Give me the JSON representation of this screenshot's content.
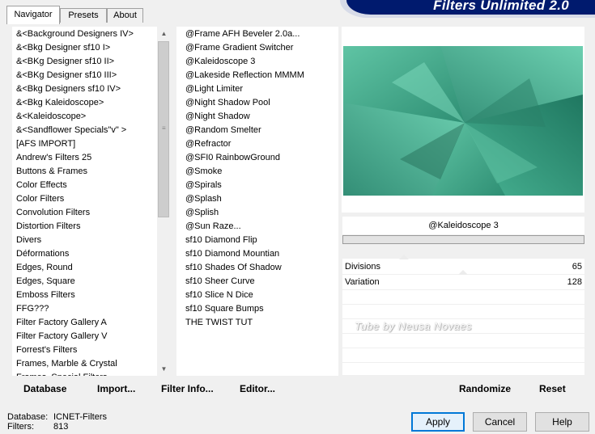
{
  "tabs": [
    {
      "label": "Navigator",
      "active": true
    },
    {
      "label": "Presets",
      "active": false
    },
    {
      "label": "About",
      "active": false
    }
  ],
  "app_title": "Filters Unlimited 2.0",
  "categories": [
    "&<Background Designers IV>",
    "&<Bkg Designer sf10 I>",
    "&<BKg Designer sf10 II>",
    "&<BKg Designer sf10 III>",
    "&<Bkg Designers sf10 IV>",
    "&<Bkg Kaleidoscope>",
    "&<Kaleidoscope>",
    "&<Sandflower Specials\"v\" >",
    "[AFS IMPORT]",
    "Andrew's Filters 25",
    "Buttons & Frames",
    "Color Effects",
    "Color Filters",
    "Convolution Filters",
    "Distortion Filters",
    "Divers",
    "Déformations",
    "Edges, Round",
    "Edges, Square",
    "Emboss Filters",
    "FFG???",
    "Filter Factory Gallery A",
    "Filter Factory Gallery V",
    "Forrest's Filters",
    "Frames, Marble & Crystal",
    "Frames, Special Filters"
  ],
  "filters": [
    "@Frame AFH Beveler 2.0a...",
    "@Frame Gradient Switcher",
    "@Kaleidoscope 3",
    "@Lakeside Reflection MMMM",
    "@Light Limiter",
    "@Night Shadow Pool",
    "@Night Shadow",
    "@Random Smelter",
    "@Refractor",
    "@SFI0 RainbowGround",
    "@Smoke",
    "@Spirals",
    "@Splash",
    "@Splish",
    "@Sun Raze...",
    "sf10 Diamond Flip",
    "sf10 Diamond Mountian",
    "sf10 Shades Of Shadow",
    "sf10 Sheer Curve",
    "sf10 Slice N Dice",
    "sf10 Square Bumps",
    "THE TWIST TUT"
  ],
  "selected_filter": "@Kaleidoscope 3",
  "parameters": [
    {
      "label": "Divisions",
      "value": "65"
    },
    {
      "label": "Variation",
      "value": "128"
    }
  ],
  "watermark": "Tube by Neusa Novaes",
  "toolbar": {
    "database": "Database",
    "import": "Import...",
    "filter_info": "Filter Info...",
    "editor": "Editor...",
    "randomize": "Randomize",
    "reset": "Reset"
  },
  "status": {
    "database_label": "Database:",
    "database_value": "ICNET-Filters",
    "filters_label": "Filters:",
    "filters_value": "813"
  },
  "buttons": {
    "apply": "Apply",
    "cancel": "Cancel",
    "help": "Help"
  },
  "colors": {
    "banner": "#001a6e",
    "preview_teal": "#3fa889"
  }
}
